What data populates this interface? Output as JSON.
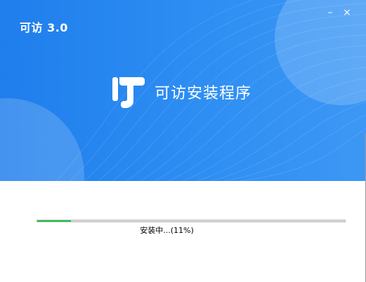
{
  "window": {
    "title": "可访 3.0",
    "minimize_label": "–",
    "close_label": "×"
  },
  "hero": {
    "brand_text": "可访安装程序",
    "logo_icon": "kefang-logo-icon",
    "colors": {
      "background": "#2b89f1",
      "accent": "#ffffff"
    }
  },
  "progress": {
    "percent": 11,
    "status_text": "安装中...(11%)",
    "fill_color": "#19c23c"
  }
}
